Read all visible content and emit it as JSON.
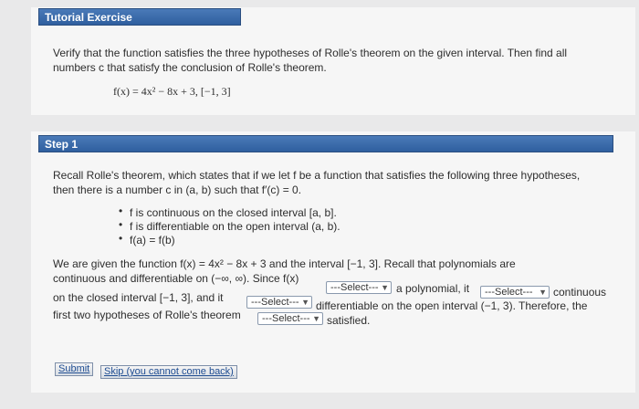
{
  "tutorial": {
    "header": "Tutorial Exercise",
    "prompt_line1": "Verify that the function satisfies the three hypotheses of Rolle's theorem on the given interval. Then find all",
    "prompt_line2": "numbers c that satisfy the conclusion of Rolle's theorem.",
    "function": "f(x) = 4x² − 8x + 3,   [−1, 3]"
  },
  "step": {
    "header": "Step 1",
    "recall_line1": "Recall Rolle's theorem, which states that if we let f be a function that satisfies the following three hypotheses,",
    "recall_line2": "then there is a number c in (a, b) such that f′(c) = 0.",
    "hypotheses": [
      "f is continuous on the closed interval [a, b].",
      "f is differentiable on the open interval (a, b).",
      "f(a) = f(b)"
    ],
    "para_line1": "We are given the function f(x) = 4x² − 8x + 3 and the interval [−1, 3]. Recall that polynomials are",
    "para_line2_a": "continuous and differentiable on (−∞, ∞). Since f(x)",
    "para_line2_b": "a polynomial, it",
    "para_line2_c": "continuous",
    "para_line3_a": "on the closed interval [−1, 3], and it",
    "para_line3_b": "differentiable on the open interval (−1, 3). Therefore, the",
    "para_line4_a": "first two hypotheses of Rolle's theorem",
    "para_line4_b": "satisfied.",
    "select_placeholder": "---Select---",
    "submit_label": "Submit",
    "skip_label": "Skip (you cannot come back)"
  },
  "colors": {
    "header_bg": "#3a6aaa",
    "panel_bg": "#f6f6f6"
  }
}
